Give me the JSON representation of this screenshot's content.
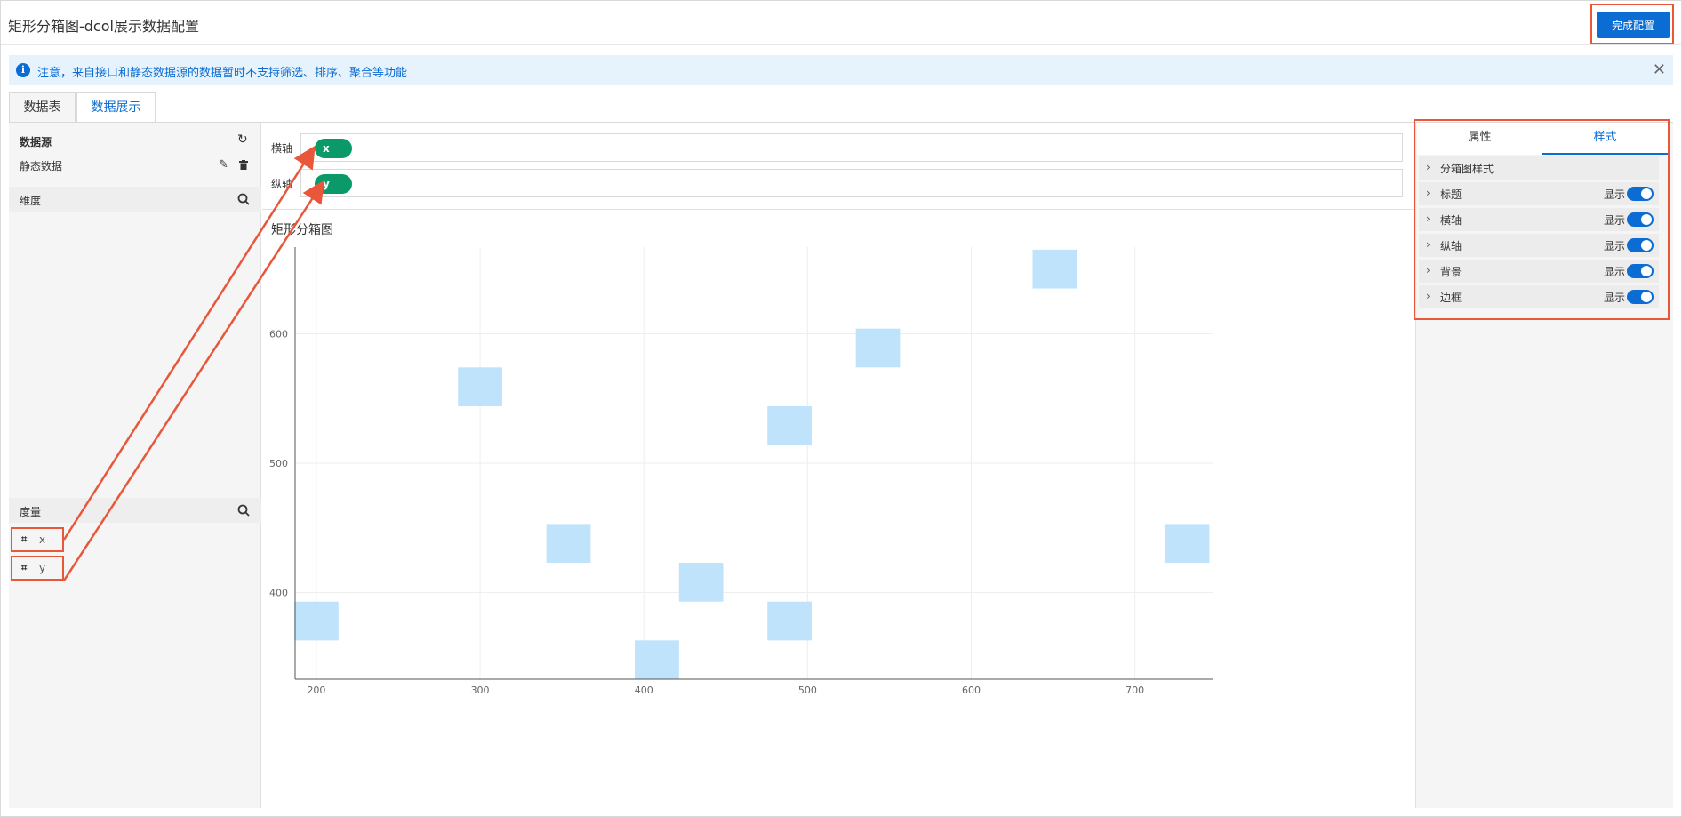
{
  "header": {
    "title": "矩形分箱图-dcol展示数据配置",
    "done_button": "完成配置"
  },
  "notice": {
    "icon": "info-icon",
    "text": "注意，来自接口和静态数据源的数据暂时不支持筛选、排序、聚合等功能",
    "close": "✕"
  },
  "tabs": [
    {
      "label": "数据表",
      "active": false
    },
    {
      "label": "数据展示",
      "active": true
    }
  ],
  "left_panel": {
    "datasource_label": "数据源",
    "datasource_value": "静态数据",
    "dimension_label": "维度",
    "measure_label": "度量",
    "fields": [
      {
        "type_icon": "⌗",
        "name": "x"
      },
      {
        "type_icon": "⌗",
        "name": "y"
      }
    ]
  },
  "axes": {
    "x_label": "横轴",
    "x_field": "x",
    "y_label": "纵轴",
    "y_field": "y"
  },
  "right_panel": {
    "tabs": [
      {
        "label": "属性",
        "active": false
      },
      {
        "label": "样式",
        "active": true
      }
    ],
    "rows": [
      {
        "label": "分箱图样式",
        "toggle": false
      },
      {
        "label": "标题",
        "toggle": true,
        "show_label": "显示"
      },
      {
        "label": "横轴",
        "toggle": true,
        "show_label": "显示"
      },
      {
        "label": "纵轴",
        "toggle": true,
        "show_label": "显示"
      },
      {
        "label": "背景",
        "toggle": true,
        "show_label": "显示"
      },
      {
        "label": "边框",
        "toggle": true,
        "show_label": "显示"
      }
    ]
  },
  "colors": {
    "accent": "#0b6cd3",
    "pill": "#0a9a6a",
    "highlight": "#e8573a",
    "bin": "#bee3fa"
  },
  "chart_data": {
    "type": "heatmap",
    "title": "矩形分箱图",
    "xlim": [
      187,
      748
    ],
    "ylim": [
      333,
      667
    ],
    "x_ticks": [
      200,
      300,
      400,
      500,
      600,
      700
    ],
    "y_ticks": [
      400,
      500,
      600
    ],
    "bin_width": 27,
    "bin_height": 30,
    "bins": [
      {
        "x": 200,
        "y": 378
      },
      {
        "x": 300,
        "y": 559
      },
      {
        "x": 354,
        "y": 438
      },
      {
        "x": 408,
        "y": 348
      },
      {
        "x": 435,
        "y": 408
      },
      {
        "x": 489,
        "y": 529
      },
      {
        "x": 489,
        "y": 378
      },
      {
        "x": 543,
        "y": 589
      },
      {
        "x": 651,
        "y": 650
      },
      {
        "x": 732,
        "y": 438
      }
    ]
  }
}
